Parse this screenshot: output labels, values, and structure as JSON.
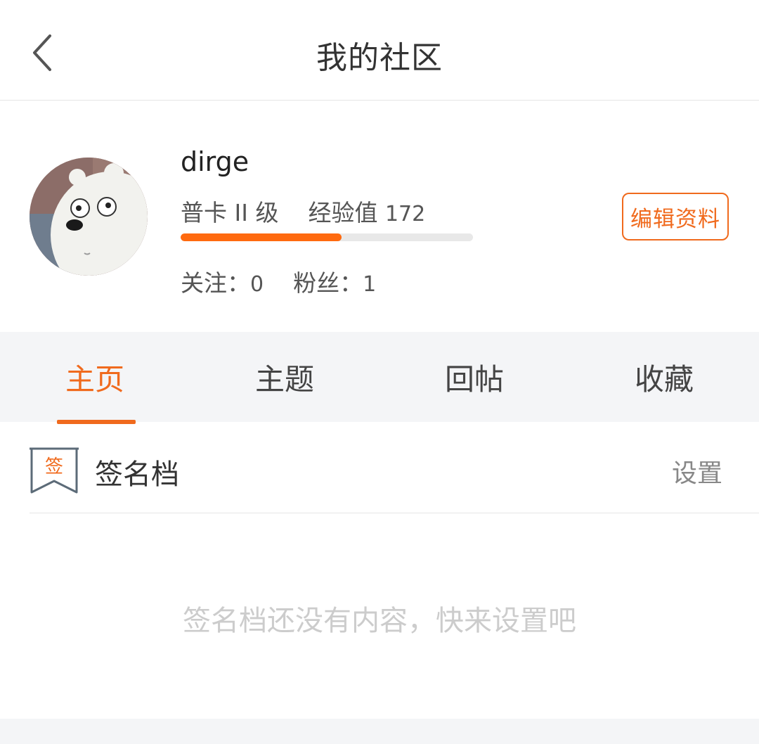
{
  "header": {
    "title": "我的社区",
    "back_icon": "chevron-left-icon"
  },
  "profile": {
    "username": "dirge",
    "level": "普卡 II 级",
    "exp_label": "经验值",
    "exp_value": "172",
    "exp_progress": 0.55,
    "following_label": "关注：",
    "following_value": "0",
    "followers_label": "粉丝：",
    "followers_value": "1",
    "edit_button": "编辑资料"
  },
  "tabs": [
    {
      "label": "主页",
      "active": true
    },
    {
      "label": "主题",
      "active": false
    },
    {
      "label": "回帖",
      "active": false
    },
    {
      "label": "收藏",
      "active": false
    }
  ],
  "signature": {
    "icon_char": "签",
    "label": "签名档",
    "setting": "设置",
    "empty_text": "签名档还没有内容，快来设置吧"
  },
  "colors": {
    "accent": "#f06a1d",
    "progress": "#ff6a0f",
    "tab_bg": "#f4f5f7"
  }
}
